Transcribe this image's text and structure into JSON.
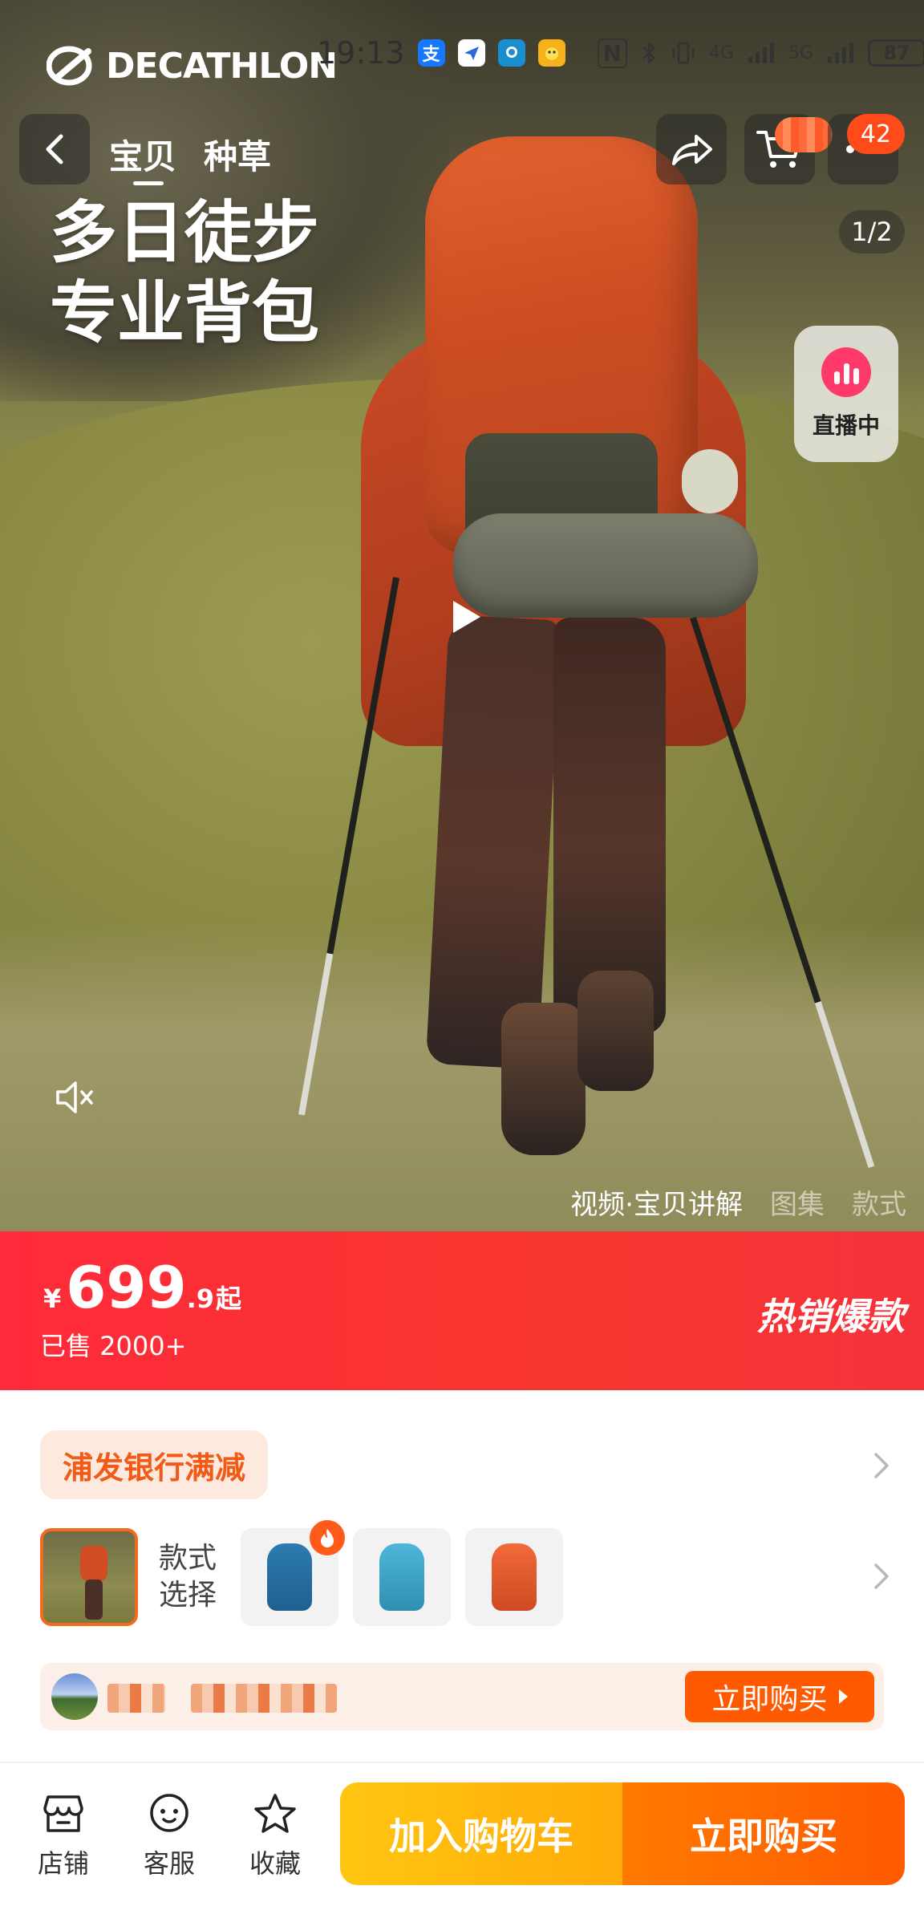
{
  "status_bar": {
    "time": "19:13",
    "apps": [
      {
        "icon": "alipay-icon",
        "glyph": "支",
        "color": "#1677ff"
      },
      {
        "icon": "messenger-icon",
        "glyph": "◆",
        "color": "#2a6bd8"
      },
      {
        "icon": "assistant-icon",
        "glyph": "●",
        "color": "#1a8fd0"
      },
      {
        "icon": "game-icon",
        "glyph": "●",
        "color": "#f7b21b"
      }
    ],
    "nfc": "N",
    "signal_a": "4G",
    "signal_b": "5G",
    "battery": "87"
  },
  "brand": {
    "name": "DECATHLON"
  },
  "nav": {
    "tabs": [
      {
        "label": "宝贝",
        "active": true
      },
      {
        "label": "种草",
        "active": false
      }
    ],
    "count_badge": "42"
  },
  "hero": {
    "headline_line1": "多日徒步",
    "headline_line2": "专业背包",
    "page_indicator": "1/2",
    "live_label": "直播中",
    "media_tabs": [
      {
        "label": "视频·宝贝讲解",
        "active": true
      },
      {
        "label": "图集",
        "active": false
      },
      {
        "label": "款式",
        "active": false
      }
    ]
  },
  "price": {
    "currency": "¥",
    "integer": "699",
    "decimal": ".9",
    "suffix": "起",
    "sold": "已售 2000+",
    "tag": "热销爆款"
  },
  "detail": {
    "promo": "浦发银行满减",
    "sku_label": "款式选择",
    "sku_options": [
      {
        "icon": "backpack-blue-icon",
        "color": "#1f5f8f",
        "hot": true
      },
      {
        "icon": "backpack-teal-icon",
        "color": "#3aa3c9",
        "hot": false
      },
      {
        "icon": "backpack-orange-icon",
        "color": "#e25a30",
        "hot": false
      }
    ],
    "buy_now_label": "立即购买"
  },
  "bottom_bar": {
    "store": "店铺",
    "service": "客服",
    "favorite": "收藏",
    "add_to_cart": "加入购物车",
    "buy_now": "立即购买"
  },
  "colors": {
    "price_banner": "#f7362f",
    "accent_orange": "#ff5a00",
    "cart_yellow": "#ffb80c",
    "promo_text": "#f25a16"
  }
}
